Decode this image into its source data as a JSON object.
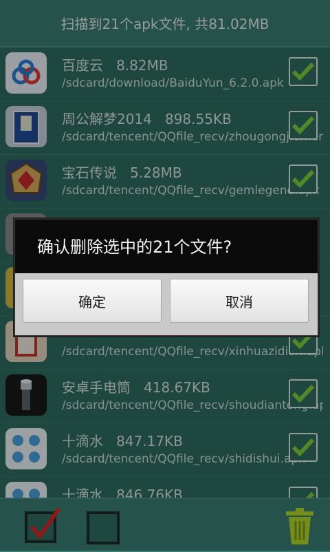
{
  "header": {
    "title": "扫描到21个apk文件, 共81.02MB"
  },
  "rows": [
    {
      "title": "百度云   8.82MB",
      "path": "/sdcard/download/BaiduYun_6.2.0.apk",
      "checked": true
    },
    {
      "title": "周公解梦2014   898.55KB",
      "path": "/sdcard/tencent/QQfile_recv/zhougongjiemeng...",
      "checked": true
    },
    {
      "title": "宝石传说   5.28MB",
      "path": "/sdcard/tencent/QQfile_recv/gemlegend.apk",
      "checked": true
    },
    {
      "title": "",
      "path": "",
      "checked": true
    },
    {
      "title": "",
      "path": "",
      "checked": true
    },
    {
      "title": "",
      "path": "/sdcard/tencent/QQfile_recv/xinhuazidian.apk",
      "checked": true
    },
    {
      "title": "安卓手电筒   418.67KB",
      "path": "/sdcard/tencent/QQfile_recv/shoudiantong.apk",
      "checked": true
    },
    {
      "title": "十滴水   847.17KB",
      "path": "/sdcard/tencent/QQfile_recv/shidishui.apk",
      "checked": true
    },
    {
      "title": "十滴水   846.76KB",
      "path": "",
      "checked": true
    }
  ],
  "dialog": {
    "message": "确认删除选中的21个文件?",
    "confirm_label": "确定",
    "cancel_label": "取消"
  },
  "toolbar": {
    "select_all_icon": "checked-box-icon",
    "select_none_icon": "empty-box-icon",
    "delete_icon": "trash-icon"
  },
  "colors": {
    "background": "#2f6e63",
    "header": "#3a7e73",
    "check": "#7fd13b",
    "trash": "#b4d92a"
  }
}
